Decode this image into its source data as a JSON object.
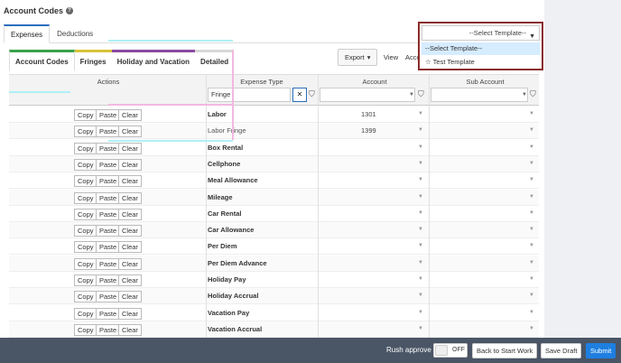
{
  "page": {
    "title": "Account Codes",
    "help_glyph": "?"
  },
  "top_tabs": [
    {
      "label": "Expenses",
      "active": true
    },
    {
      "label": "Deductions",
      "active": false
    }
  ],
  "sub_tabs": [
    {
      "label": "Account Codes",
      "active": true,
      "color": "#3aa14a"
    },
    {
      "label": "Fringes",
      "active": false,
      "color": "#d8c23a"
    },
    {
      "label": "Holiday and Vacation",
      "active": false,
      "color": "#8a4aa0"
    },
    {
      "label": "Detailed",
      "active": false,
      "color": "#d8d8d8"
    }
  ],
  "toolbar": {
    "export_label": "Export",
    "view_label": "View",
    "account_partial": "Acco"
  },
  "template": {
    "placeholder": "--Select Template--",
    "options": [
      {
        "label": "--Select Template--",
        "highlighted": true
      },
      {
        "label": "☆ Test Template",
        "highlighted": false
      }
    ]
  },
  "grid": {
    "headers": {
      "actions": "Actions",
      "expense_type": "Expense Type",
      "account": "Account",
      "sub_account": "Sub Account"
    },
    "filter_value": "Fringe",
    "action_labels": {
      "copy": "Copy",
      "paste": "Paste",
      "clear": "Clear"
    },
    "rows": [
      {
        "expense": "Labor",
        "account": "1301",
        "bold": true
      },
      {
        "expense": "Labor Fringe",
        "account": "1399",
        "bold": false
      },
      {
        "expense": "Box Rental",
        "account": "",
        "bold": true
      },
      {
        "expense": "Cellphone",
        "account": "",
        "bold": true
      },
      {
        "expense": "Meal Allowance",
        "account": "",
        "bold": true
      },
      {
        "expense": "Mileage",
        "account": "",
        "bold": true
      },
      {
        "expense": "Car Rental",
        "account": "",
        "bold": true
      },
      {
        "expense": "Car Allowance",
        "account": "",
        "bold": true
      },
      {
        "expense": "Per Diem",
        "account": "",
        "bold": true
      },
      {
        "expense": "Per Diem Advance",
        "account": "",
        "bold": true
      },
      {
        "expense": "Holiday Pay",
        "account": "",
        "bold": true
      },
      {
        "expense": "Holiday Accrual",
        "account": "",
        "bold": true
      },
      {
        "expense": "Vacation Pay",
        "account": "",
        "bold": true
      },
      {
        "expense": "Vacation Accrual",
        "account": "",
        "bold": true
      }
    ]
  },
  "bottom_bar": {
    "rush_label": "Rush approve",
    "toggle_state": "OFF",
    "back_label": "Back to Start Work",
    "draft_label": "Save Draft",
    "submit_label": "Submit"
  },
  "colors": {
    "accent": "#2a6ebb",
    "submit": "#1e7fe0",
    "bar": "#4a5566",
    "highlight_border": "#8b2b2b"
  }
}
